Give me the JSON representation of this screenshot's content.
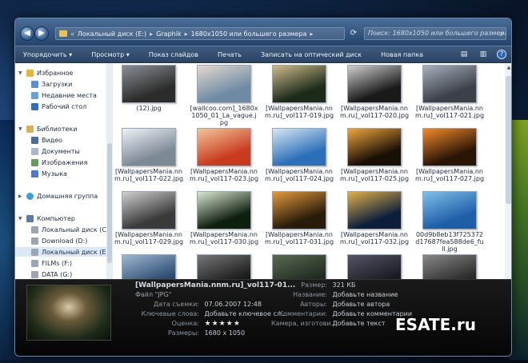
{
  "address": {
    "breadcrumb": [
      "Локальный диск (E:)",
      "Graphik",
      "1680х1050 или большего размера"
    ],
    "search_placeholder": "Поиск: 1680х1050 или большего размера"
  },
  "toolbar": {
    "organize": "Упорядочить ▾",
    "preview": "Просмотр ▾",
    "slideshow": "Показ слайдов",
    "print": "Печать",
    "burn": "Записать на оптический диск",
    "new_folder": "Новая папка"
  },
  "nav": {
    "favorites": "Избранное",
    "downloads": "Загрузки",
    "recent": "Недавние места",
    "desktop": "Рабочий стол",
    "libraries": "Библиотеки",
    "video": "Видео",
    "documents": "Документы",
    "images": "Изображения",
    "music": "Музыка",
    "homegroup": "Домашняя группа",
    "computer": "Компьютер",
    "drive_c": "Локальный диск (C:)",
    "drive_d": "Download (D:)",
    "drive_e": "Локальный диск (E:)",
    "drive_f": "FILMs (F:)",
    "drive_g": "DATA (G:)"
  },
  "files": [
    {
      "label": "(12).jpg",
      "c1": "#2c2c2c",
      "c2": "#8a8f95"
    },
    {
      "label": "[wallcoo.com]_1680x1050_01_La_vague.jpg",
      "c1": "#6f8aa3",
      "c2": "#e3d8cf"
    },
    {
      "label": "[WallpapersMania.nnm.ru]_vol117-019.jpg",
      "c1": "#1c2a18",
      "c2": "#cdbb8d"
    },
    {
      "label": "[WallpapersMania.nnm.ru]_vol117-020.jpg",
      "c1": "#1a1a1a",
      "c2": "#d0d0d0"
    },
    {
      "label": "[WallpapersMania.nnm.ru]_vol117-021.jpg",
      "c1": "#3c4048",
      "c2": "#a9b1bd"
    },
    {
      "label": "[WallpapersMania.nnm.ru]_vol117-022.jpg",
      "c1": "#7d8a96",
      "c2": "#eef2f6"
    },
    {
      "label": "[WallpapersMania.nnm.ru]_vol117-023.jpg",
      "c1": "#c93b1f",
      "c2": "#f1c69a"
    },
    {
      "label": "[WallpapersMania.nnm.ru]_vol117-024.jpg",
      "c1": "#2b6fb8",
      "c2": "#d8e6f2"
    },
    {
      "label": "[WallpapersMania.nnm.ru]_vol117-025.jpg",
      "c1": "#1a0f05",
      "c2": "#f0a53a"
    },
    {
      "label": "[WallpapersMania.nnm.ru]_vol117-027.jpg",
      "c1": "#2a1405",
      "c2": "#f28a2a"
    },
    {
      "label": "[WallpapersMania.nnm.ru]_vol117-029.jpg",
      "c1": "#3a3a3a",
      "c2": "#cfcfcf"
    },
    {
      "label": "[WallpapersMania.nnm.ru]_vol117-030.jpg",
      "c1": "#0f1f0f",
      "c2": "#d9e8d0"
    },
    {
      "label": "[WallpapersMania.nnm.ru]_vol117-031.jpg",
      "c1": "#2a1c0a",
      "c2": "#e39a3c"
    },
    {
      "label": "[WallpapersMania.nnm.ru]_vol117-032.jpg",
      "c1": "#0c1e3a",
      "c2": "#e2b04a"
    },
    {
      "label": "00d9b8eb13f725372d17687fea588de6_full.jpg",
      "c1": "#1f5fa8",
      "c2": "#7fc0e8"
    },
    {
      "label": "",
      "c1": "#2a4a70",
      "c2": "#9fb8d0"
    },
    {
      "label": "",
      "c1": "#1a1a1a",
      "c2": "#777777"
    },
    {
      "label": "",
      "c1": "#1f2a20",
      "c2": "#5a6a50"
    },
    {
      "label": "",
      "c1": "#1a1a22",
      "c2": "#555566"
    },
    {
      "label": "",
      "c1": "#2a2a2a",
      "c2": "#888888"
    }
  ],
  "details": {
    "name": "[WallpapersMania.nnm.ru]_vol117-01...",
    "type": "Файл \"JPG\"",
    "date_label": "Дата съемки:",
    "date_value": "07.06.2007 12:48",
    "keywords_label": "Ключевые слова:",
    "keywords_value": "Добавьте ключевое сл...",
    "rating_label": "Оценка:",
    "rating_stars": "★★★★★",
    "dims_label": "Размеры:",
    "dims_value": "1680 x 1050",
    "size_label": "Размер:",
    "size_value": "321 КБ",
    "title_label": "Название:",
    "title_value": "Добавьте название",
    "authors_label": "Авторы:",
    "authors_value": "Добавьте автора",
    "comments_label": "Комментарии:",
    "comments_value": "Добавьте комментарии",
    "camera_label": "Камера, изготови...",
    "camera_value": "Добавьте текст"
  },
  "watermark": "ESATE.ru"
}
